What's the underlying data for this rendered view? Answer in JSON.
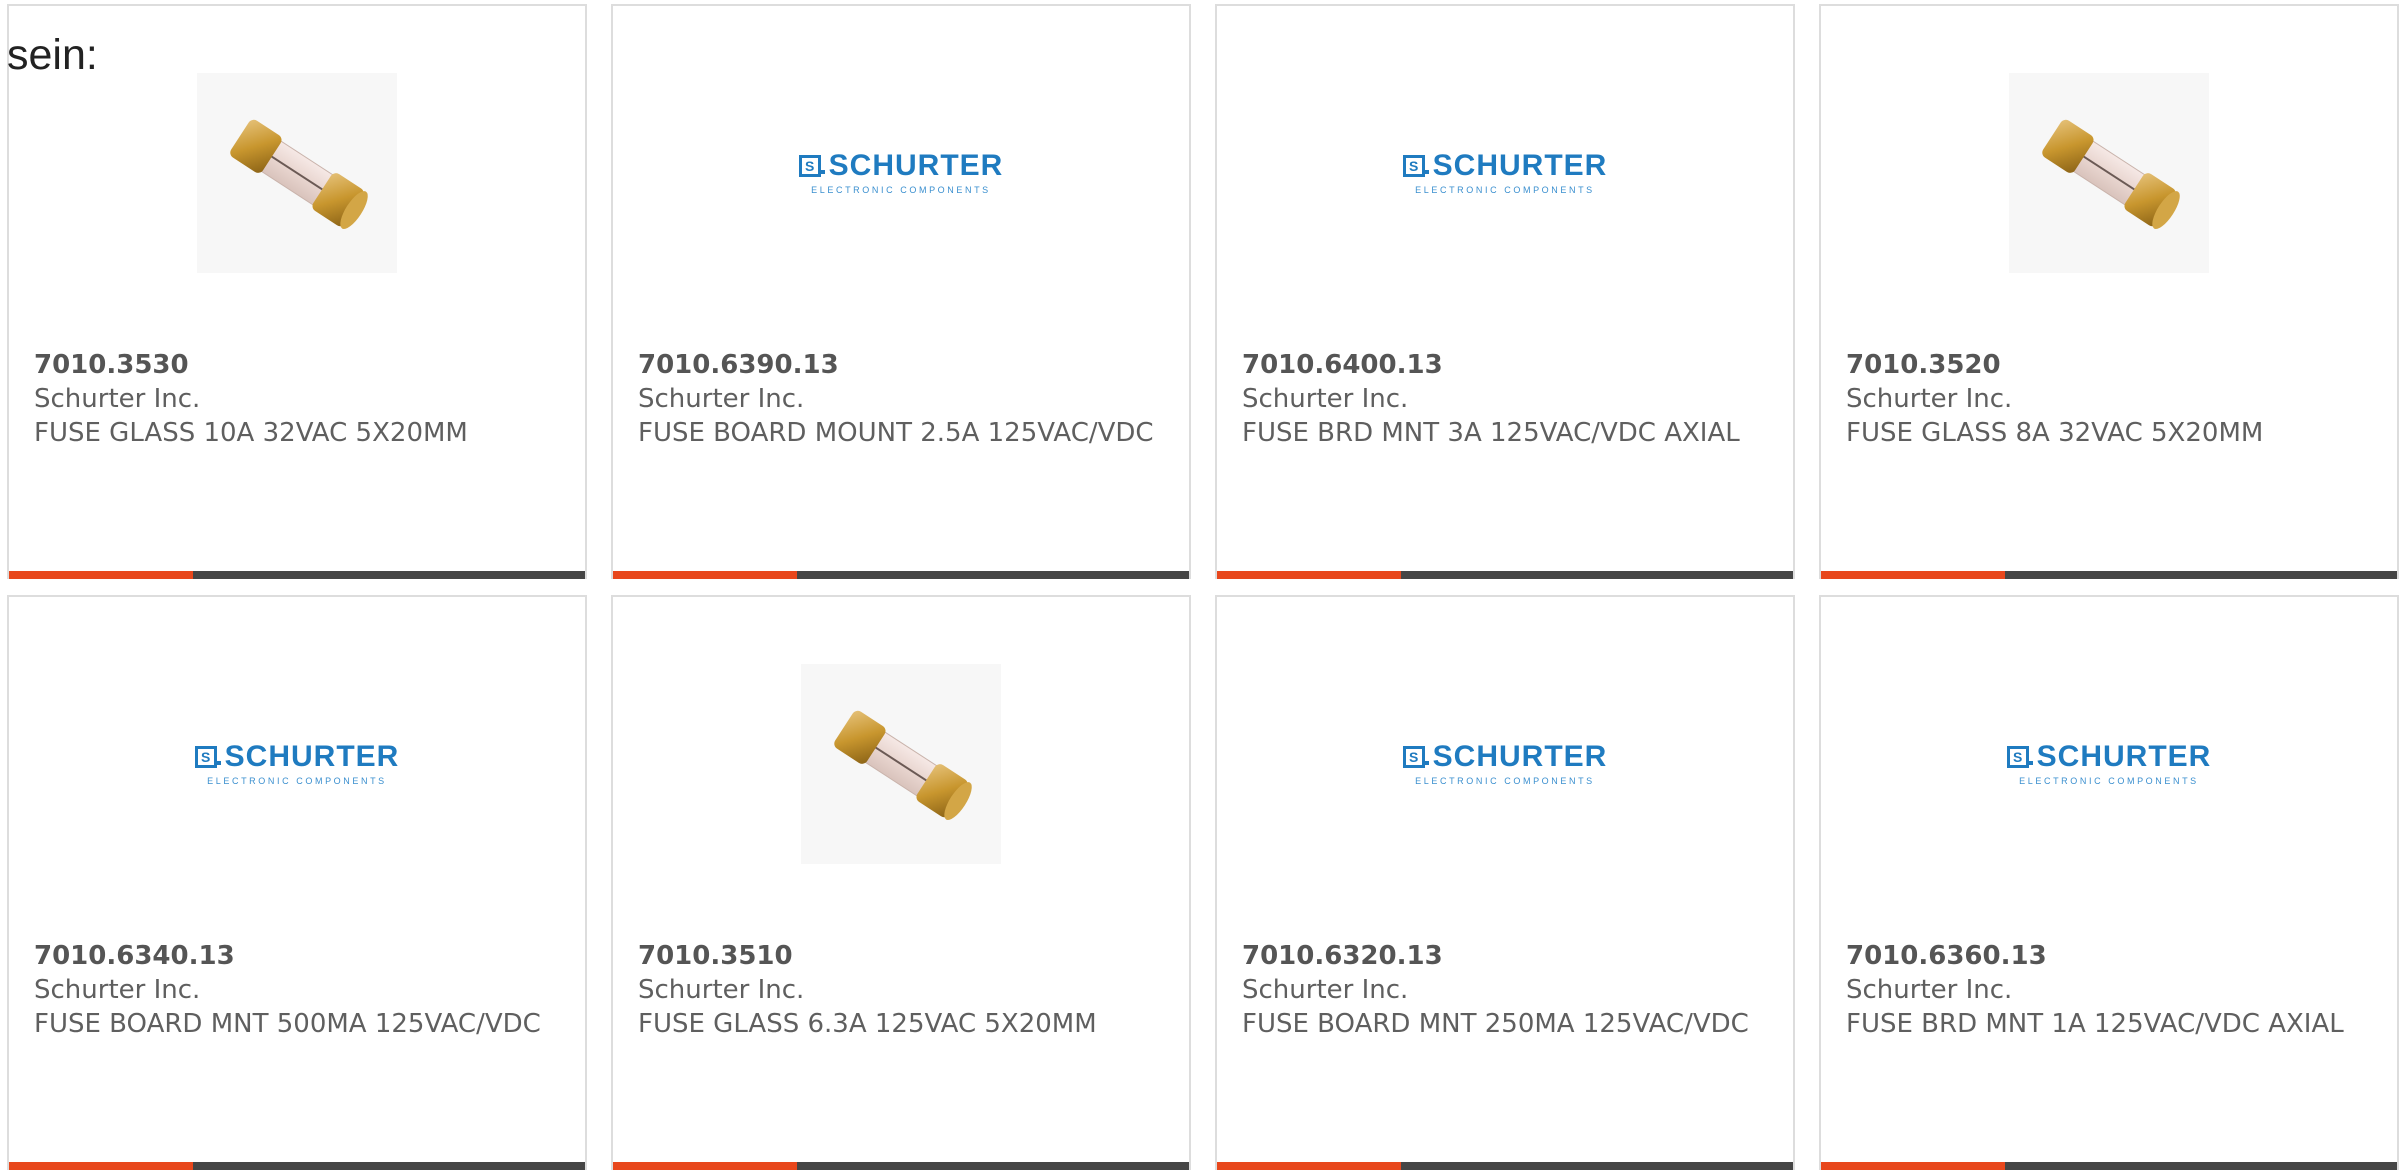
{
  "intro_text": "sein:",
  "colors": {
    "accent": "#e8471c",
    "bar": "#454545",
    "brand_blue": "#1f7bc0"
  },
  "products": [
    {
      "part_number": "7010.3530",
      "manufacturer": "Schurter Inc.",
      "description": "FUSE GLASS 10A 32VAC 5X20MM",
      "image": "fuse-photo"
    },
    {
      "part_number": "7010.6390.13",
      "manufacturer": "Schurter Inc.",
      "description": "FUSE BOARD MOUNT 2.5A 125VAC/VDC",
      "image": "schurter-logo"
    },
    {
      "part_number": "7010.6400.13",
      "manufacturer": "Schurter Inc.",
      "description": "FUSE BRD MNT 3A 125VAC/VDC AXIAL",
      "image": "schurter-logo"
    },
    {
      "part_number": "7010.3520",
      "manufacturer": "Schurter Inc.",
      "description": "FUSE GLASS 8A 32VAC 5X20MM",
      "image": "fuse-photo"
    },
    {
      "part_number": "7010.6340.13",
      "manufacturer": "Schurter Inc.",
      "description": "FUSE BOARD MNT 500MA 125VAC/VDC",
      "image": "schurter-logo"
    },
    {
      "part_number": "7010.3510",
      "manufacturer": "Schurter Inc.",
      "description": "FUSE GLASS 6.3A 125VAC 5X20MM",
      "image": "fuse-photo"
    },
    {
      "part_number": "7010.6320.13",
      "manufacturer": "Schurter Inc.",
      "description": "FUSE BOARD MNT 250MA 125VAC/VDC",
      "image": "schurter-logo"
    },
    {
      "part_number": "7010.6360.13",
      "manufacturer": "Schurter Inc.",
      "description": "FUSE BRD MNT 1A 125VAC/VDC AXIAL",
      "image": "schurter-logo"
    }
  ],
  "logo": {
    "wordmark": "SCHURTER",
    "tagline": "ELECTRONIC COMPONENTS",
    "mark_letter": "S"
  }
}
